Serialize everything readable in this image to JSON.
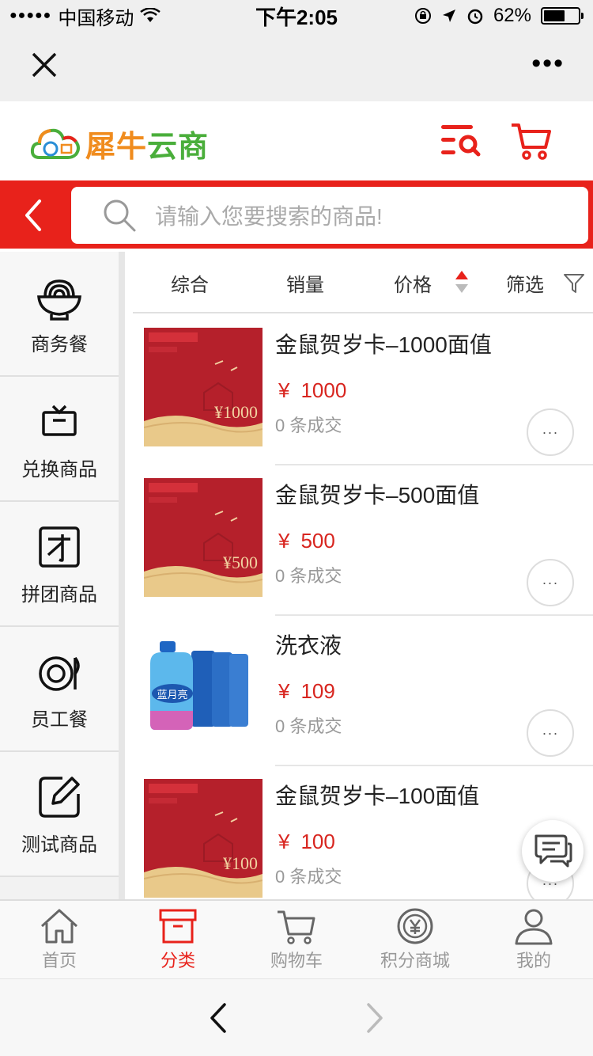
{
  "status_bar": {
    "carrier": "中国移动",
    "time": "下午2:05",
    "battery": "62%",
    "battery_level": 0.62
  },
  "wx_nav": {
    "close_icon": "close-icon",
    "more_icon": "more-icon"
  },
  "header": {
    "logo_part1": "犀牛",
    "logo_part2": "云商",
    "menu_search_icon": "menu-search-icon",
    "cart_icon": "cart-icon"
  },
  "search": {
    "placeholder": "请输入您要搜索的商品!"
  },
  "sidebar": {
    "items": [
      {
        "label": "商务餐",
        "icon": "bowl-icon"
      },
      {
        "label": "兑换商品",
        "icon": "gift-icon"
      },
      {
        "label": "拼团商品",
        "icon": "group-icon"
      },
      {
        "label": "员工餐",
        "icon": "dish-icon"
      },
      {
        "label": "测试商品",
        "icon": "edit-icon"
      }
    ]
  },
  "sort": {
    "all": "综合",
    "sales": "销量",
    "price": "价格",
    "filter": "筛选"
  },
  "products": [
    {
      "title": "金鼠贺岁卡–1000面值",
      "currency": "¥",
      "price": "1000",
      "sold": "0 条成交",
      "card_value": "¥1000"
    },
    {
      "title": "金鼠贺岁卡–500面值",
      "currency": "¥",
      "price": "500",
      "sold": "0 条成交",
      "card_value": "¥500"
    },
    {
      "title": "洗衣液",
      "currency": "¥",
      "price": "109",
      "sold": "0 条成交",
      "brand": "蓝月亮"
    },
    {
      "title": "金鼠贺岁卡–100面值",
      "currency": "¥",
      "price": "100",
      "sold": "0 条成交",
      "card_value": "¥100"
    }
  ],
  "more_label": "···",
  "tabbar": {
    "items": [
      {
        "label": "首页",
        "icon": "home-icon"
      },
      {
        "label": "分类",
        "icon": "category-icon",
        "active": true
      },
      {
        "label": "购物车",
        "icon": "cart-icon"
      },
      {
        "label": "积分商城",
        "icon": "points-icon"
      },
      {
        "label": "我的",
        "icon": "user-icon"
      }
    ]
  },
  "colors": {
    "brand_red": "#e8221b",
    "price_red": "#d8251f",
    "logo_orange": "#f08c1e",
    "logo_green": "#4aae3b"
  }
}
